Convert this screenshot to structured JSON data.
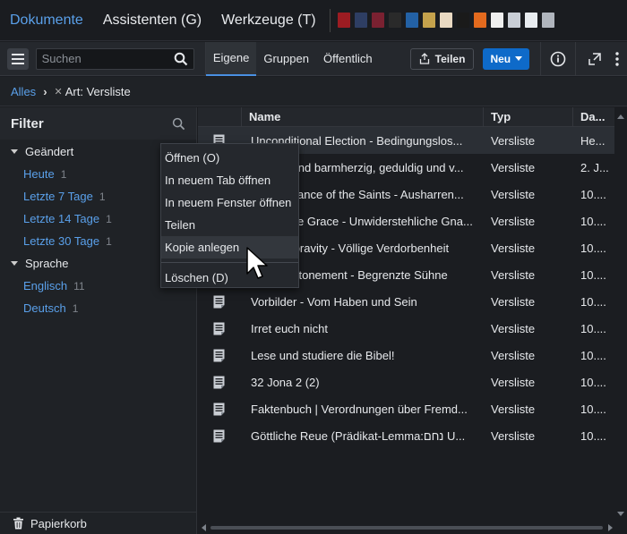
{
  "topnav": {
    "tabs": [
      {
        "label": "Dokumente",
        "active": true
      },
      {
        "label": "Assistenten (G)",
        "active": false
      },
      {
        "label": "Werkzeuge (T)",
        "active": false
      }
    ],
    "thumb_colors": [
      "#9c1c22",
      "#2e3e63",
      "#7a2131",
      "#2a2a2a",
      "#2361a5",
      "#c5a24c",
      "#e9d9c2",
      "#1a1a1a",
      "#e36a1e",
      "#efefef",
      "#c9ced6",
      "#e8ecf0",
      "#b0b5bd"
    ]
  },
  "toolbar": {
    "search_placeholder": "Suchen",
    "scopes": [
      "Eigene",
      "Gruppen",
      "Öffentlich"
    ],
    "share_label": "Teilen",
    "new_label": "Neu"
  },
  "breadcrumb": {
    "root": "Alles",
    "filter": "Art: Versliste"
  },
  "sidebar": {
    "title": "Filter",
    "groups": [
      {
        "label": "Geändert",
        "items": [
          {
            "label": "Heute",
            "count": "1"
          },
          {
            "label": "Letzte 7 Tage",
            "count": "1"
          },
          {
            "label": "Letzte 14 Tage",
            "count": "1"
          },
          {
            "label": "Letzte 30 Tage",
            "count": "1"
          }
        ]
      },
      {
        "label": "Sprache",
        "items": [
          {
            "label": "Englisch",
            "count": "11"
          },
          {
            "label": "Deutsch",
            "count": "1"
          }
        ]
      }
    ],
    "trash_label": "Papierkorb"
  },
  "table": {
    "headers": {
      "name": "Name",
      "type": "Typ",
      "date": "Da..."
    },
    "rows": [
      {
        "name": "Unconditional Election - Bedingungslos...",
        "type": "Versliste",
        "date": "He..."
      },
      {
        "name": "Gnädig und barmherzig, geduldig und v...",
        "type": "Versliste",
        "date": "2. J..."
      },
      {
        "name": "Perseverance of the Saints - Ausharren...",
        "type": "Versliste",
        "date": "10...."
      },
      {
        "name": "Irresistible Grace - Unwiderstehliche Gna...",
        "type": "Versliste",
        "date": "10...."
      },
      {
        "name": "Total Depravity - Völlige Verdorbenheit",
        "type": "Versliste",
        "date": "10...."
      },
      {
        "name": "Limited Atonement - Begrenzte Sühne",
        "type": "Versliste",
        "date": "10...."
      },
      {
        "name": "Vorbilder - Vom Haben und Sein",
        "type": "Versliste",
        "date": "10...."
      },
      {
        "name": "Irret euch nicht",
        "type": "Versliste",
        "date": "10...."
      },
      {
        "name": "Lese und studiere die Bibel!",
        "type": "Versliste",
        "date": "10...."
      },
      {
        "name": "32 Jona 2 (2)",
        "type": "Versliste",
        "date": "10...."
      },
      {
        "name": "Faktenbuch | Verordnungen über Fremd...",
        "type": "Versliste",
        "date": "10...."
      },
      {
        "name": "Göttliche Reue (Prädikat-Lemma:נחם U...",
        "type": "Versliste",
        "date": "10...."
      }
    ]
  },
  "context_menu": {
    "items": [
      "Öffnen (O)",
      "In neuem Tab öffnen",
      "In neuem Fenster öffnen",
      "Teilen",
      "Kopie anlegen"
    ],
    "danger_item": "Löschen (D)",
    "hovered_index": 4
  }
}
